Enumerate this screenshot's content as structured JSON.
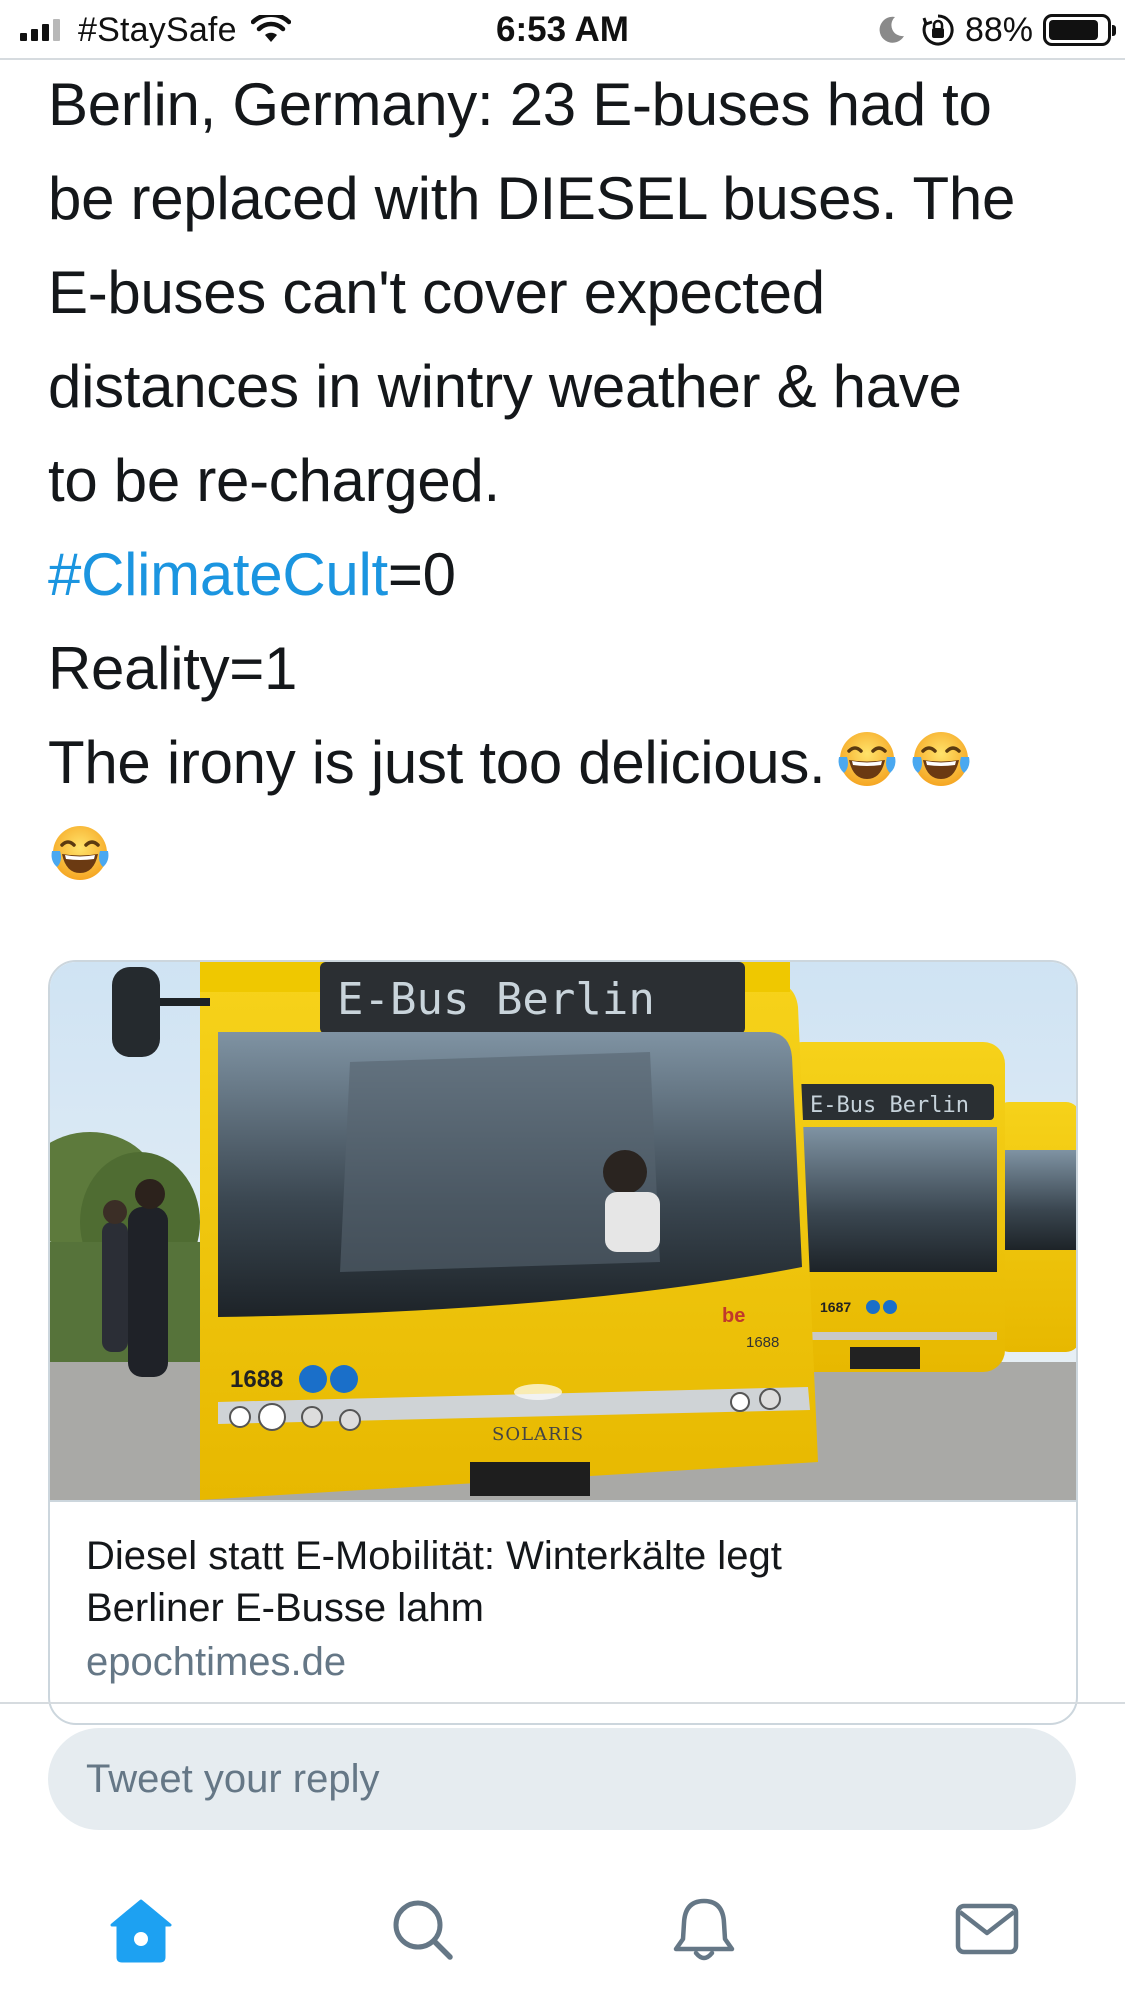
{
  "status_bar": {
    "carrier": "#StaySafe",
    "time": "6:53 AM",
    "battery_percent": "88%",
    "battery_level": 0.88,
    "icons": [
      "signal-icon",
      "wifi-icon",
      "moon-icon",
      "rotation-lock-icon",
      "battery-icon"
    ]
  },
  "tweet": {
    "lines": [
      "Berlin, Germany: 23 E-buses had to",
      "be replaced with DIESEL buses. The",
      "E-buses can't cover expected",
      "distances in wintry weather & have",
      "to be re-charged."
    ],
    "hashtag": "#ClimateCult",
    "hashtag_suffix": "=0",
    "reality_line": "Reality=1",
    "irony_line": "The irony is just too delicious.",
    "emoji": "face-with-tears-of-joy",
    "colors": {
      "text": "#14171a",
      "hashtag": "#1b95e0"
    }
  },
  "link_card": {
    "image_sign_main": "E-Bus Berlin",
    "image_sign_second": "E-Bus Berlin",
    "image_bus_number_front": "1688",
    "image_bus_number_second": "1687",
    "image_brand": "SOLARIS",
    "title_line1": "Diesel statt E-Mobilität: Winterkälte legt",
    "title_line2": "Berliner E-Busse lahm",
    "domain": "epochtimes.de"
  },
  "reply": {
    "placeholder": "Tweet your reply"
  },
  "tab_bar": {
    "items": [
      "home-icon",
      "search-icon",
      "notifications-icon",
      "messages-icon"
    ],
    "active": "home-icon",
    "colors": {
      "active": "#1da1f2",
      "inactive": "#657786"
    }
  }
}
